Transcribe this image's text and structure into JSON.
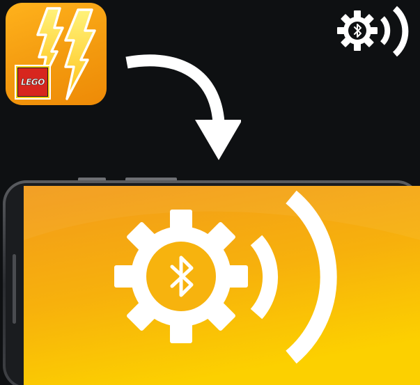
{
  "app_icon": {
    "logo_text": "LEGO",
    "icon": "lightning-bolt-icon"
  },
  "status_indicator": {
    "icon": "bluetooth-gear-signal-icon"
  },
  "flow_arrow": {
    "icon": "curved-arrow-down-icon"
  },
  "phone_screen": {
    "icon": "bluetooth-gear-signal-icon"
  },
  "colors": {
    "background": "#0e1012",
    "accent_orange": "#f39a0f",
    "accent_yellow": "#f7d117",
    "lego_red": "#d7261e",
    "icon_white": "#ffffff"
  }
}
